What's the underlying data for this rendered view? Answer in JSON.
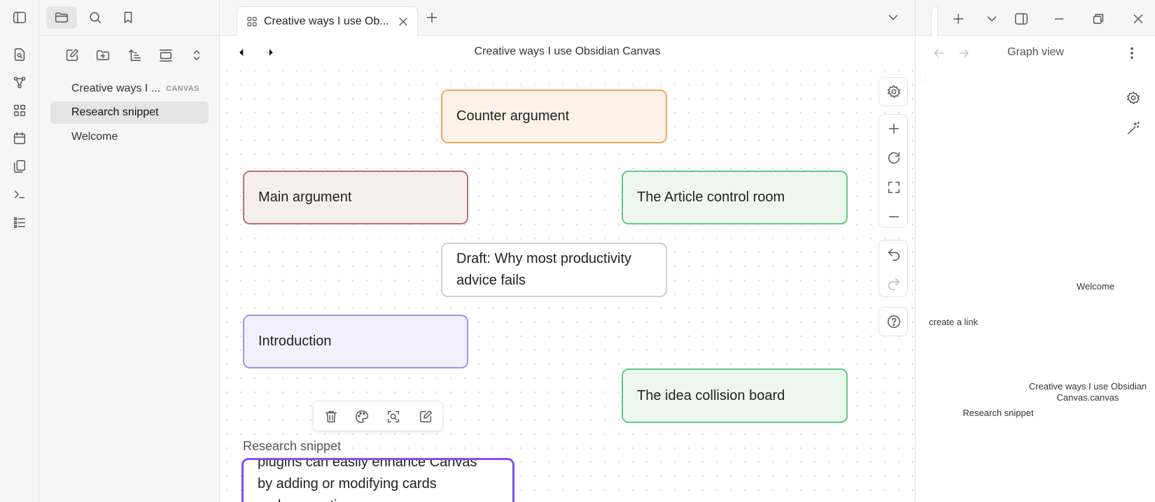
{
  "sidebar": {
    "files": [
      {
        "label": "Creative ways I ...",
        "tag": "CANVAS"
      },
      {
        "label": "Research snippet"
      },
      {
        "label": "Welcome"
      }
    ]
  },
  "tab": {
    "title": "Creative ways I use Ob..."
  },
  "main": {
    "title": "Creative ways I use Obsidian Canvas"
  },
  "canvas": {
    "nodes": {
      "counter": "Counter argument",
      "main_arg": "Main argument",
      "article": "The Article control room",
      "draft": "Draft: Why most productivity advice fails",
      "intro": "Introduction",
      "idea": "The idea collision board"
    },
    "snippet_label": "Research snippet",
    "snippet_lines": [
      "plugins can easily enhance Canvas",
      "by adding or modifying cards",
      "and connections."
    ]
  },
  "graph": {
    "title": "Graph view",
    "nodes": {
      "welcome": "Welcome",
      "create_link": "create a link",
      "canvas_file": "Creative ways I use Obsidian Canvas.canvas",
      "snippet": "Research snippet"
    },
    "colors": {
      "accent": "#8b4dea",
      "node": "#555555",
      "unresolved": "#cccccc"
    }
  }
}
